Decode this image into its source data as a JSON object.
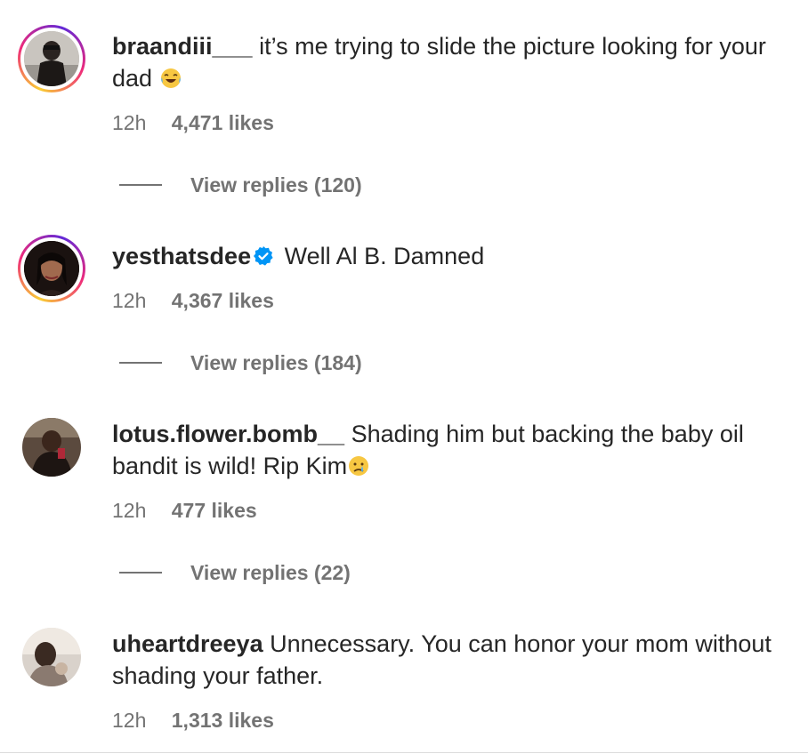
{
  "comments": [
    {
      "username": "braandiii___",
      "text": "it’s me trying to slide the picture looking for your dad",
      "emoji": "laughing-tears",
      "time": "12h",
      "likes": "4,471 likes",
      "replies": "View replies (120)",
      "avatar": "story-ring"
    },
    {
      "username": "yesthatsdee",
      "verified": true,
      "text": "Well Al B. Damned",
      "time": "12h",
      "likes": "4,367 likes",
      "replies": "View replies (184)",
      "avatar": "story-ring"
    },
    {
      "username": "lotus.flower.bomb__",
      "text": "Shading him but backing the baby oil bandit is wild! Rip Kim",
      "emoji": "crying-face",
      "time": "12h",
      "likes": "477 likes",
      "replies": "View replies (22)",
      "avatar": "plain"
    },
    {
      "username": "uheartdreeya",
      "text": "Unnecessary. You can honor your mom without shading your father.",
      "time": "12h",
      "likes": "1,313 likes",
      "avatar": "plain"
    }
  ],
  "colors": {
    "text": "#262626",
    "secondary": "#737373",
    "verified": "#0095f6"
  }
}
